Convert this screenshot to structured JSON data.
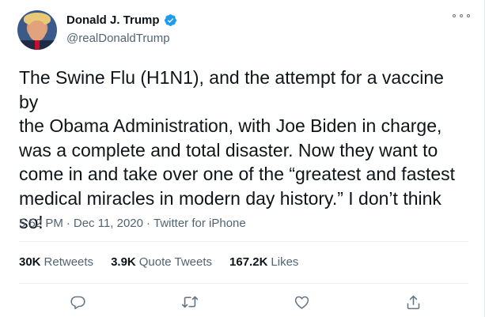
{
  "tweet": {
    "author": {
      "display_name": "Donald J. Trump",
      "handle": "@realDonaldTrump",
      "verified": true
    },
    "text": "The Swine Flu (H1N1), and the attempt for a vaccine by\nthe Obama Administration, with Joe Biden in charge,\nwas a complete and total disaster. Now they want to\ncome in and take over one of the “greatest and fastest\nmedical miracles in modern day history.” I don’t think\nso!",
    "time": "5:52 PM",
    "date": "Dec 11, 2020",
    "source": "Twitter for iPhone",
    "separator": "·"
  },
  "stats": {
    "retweets_count": "30K",
    "retweets_label": "Retweets",
    "quotes_count": "3.9K",
    "quotes_label": "Quote Tweets",
    "likes_count": "167.2K",
    "likes_label": "Likes"
  },
  "actions": {
    "reply_icon": "reply-icon",
    "retweet_icon": "retweet-icon",
    "like_icon": "heart-icon",
    "share_icon": "share-icon"
  },
  "colors": {
    "verified": "#1d9bf0",
    "muted": "#536471",
    "text": "#0f1419",
    "icon": "#657786"
  }
}
